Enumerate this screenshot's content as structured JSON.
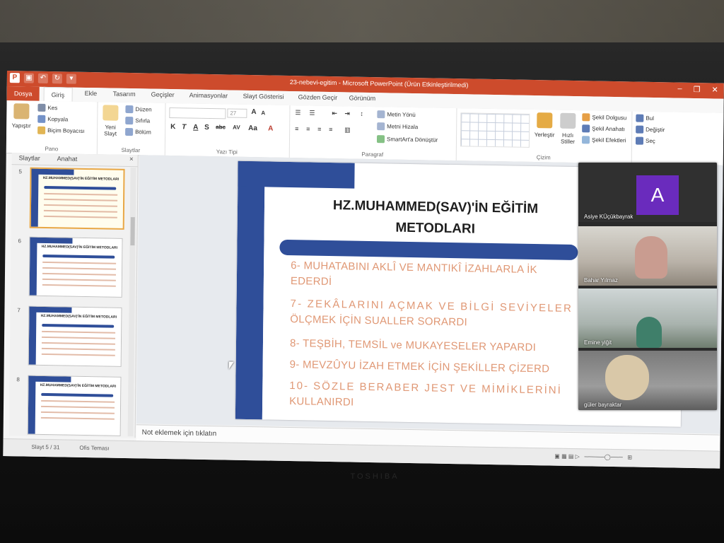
{
  "app": {
    "window_title": "23-nebevi-egitim - Microsoft PowerPoint (Ürün Etkinleştirilmedi)",
    "logo_letter": "P",
    "brand": "TOSHIBA"
  },
  "tabs": [
    "Dosya",
    "Giriş",
    "Ekle",
    "Tasarım",
    "Geçişler",
    "Animasyonlar",
    "Slayt Gösterisi",
    "Gözden Geçir",
    "Görünüm"
  ],
  "ribbon": {
    "clipboard": {
      "paste": "Yapıştır",
      "cut": "Kes",
      "copy": "Kopyala",
      "format_painter": "Biçim Boyacısı",
      "label": "Pano"
    },
    "slides": {
      "new_slide": "Yeni Slayt",
      "layout": "Düzen",
      "reset": "Sıfırla",
      "section": "Bölüm",
      "label": "Slaytlar"
    },
    "font": {
      "size": "27",
      "label": "Yazı Tipi"
    },
    "paragraph": {
      "text_direction": "Metin Yönü",
      "align_text": "Metni Hizala",
      "smartart": "SmartArt'a Dönüştür",
      "label": "Paragraf"
    },
    "drawing": {
      "arrange": "Yerleştir",
      "quick_styles": "Hızlı Stiller",
      "shape_fill": "Şekil Dolgusu",
      "shape_outline": "Şekil Anahatı",
      "shape_effects": "Şekil Efektleri",
      "label": "Çizim"
    },
    "editing": {
      "find": "Bul",
      "replace": "Değiştir",
      "select": "Seç"
    }
  },
  "left_panel": {
    "tabs": [
      "Slaytlar",
      "Anahat"
    ],
    "close": "×",
    "thumbnails": [
      {
        "num": "5",
        "title": "HZ.MUHAMMED(SAV)'İN EĞİTİM METODLARI",
        "selected": true
      },
      {
        "num": "6",
        "title": "HZ.MUHAMMED(SAV)'İN EĞİTİM METODLARI",
        "selected": false
      },
      {
        "num": "7",
        "title": "HZ.MUHAMMED(SAV)'İN EĞİTİM METODLARI",
        "selected": false
      },
      {
        "num": "8",
        "title": "HZ.MUHAMMED(SAV)'İN EĞİTİM METODLARI",
        "selected": false
      }
    ]
  },
  "slide": {
    "title_line1": "HZ.MUHAMMED(SAV)'İN EĞİTİM",
    "title_line2": "METODLARI",
    "bullets": [
      "6- MUHATABINI AKLÎ VE MANTIKÎ İZAHLARLA İK",
      "EDERDİ",
      "7- ZEKÂLARINI AÇMAK VE BİLGİ SEVİYELER",
      "ÖLÇMEK İÇİN SUALLER SORARDI",
      "8- TEŞBİH, TEMSİL ve MUKAYESELER YAPARDI",
      "9- MEVZÛYU İZAH ETMEK İÇİN ŞEKİLLER ÇİZERD",
      "10- SÖZLE BERABER JEST VE MİMİKLERİNİ",
      "KULLANIRDI"
    ]
  },
  "notes": {
    "placeholder": "Not eklemek için tıklatın"
  },
  "status": {
    "slide": "Slayt 5 / 31",
    "theme": "Ofis Teması"
  },
  "call": {
    "participants": [
      {
        "name": "Asiye KÜçükbayrak",
        "avatar_letter": "A"
      },
      {
        "name": "Bahar Yılmaz"
      },
      {
        "name": "Emine yiğit"
      },
      {
        "name": "güler bayraktar"
      }
    ]
  }
}
